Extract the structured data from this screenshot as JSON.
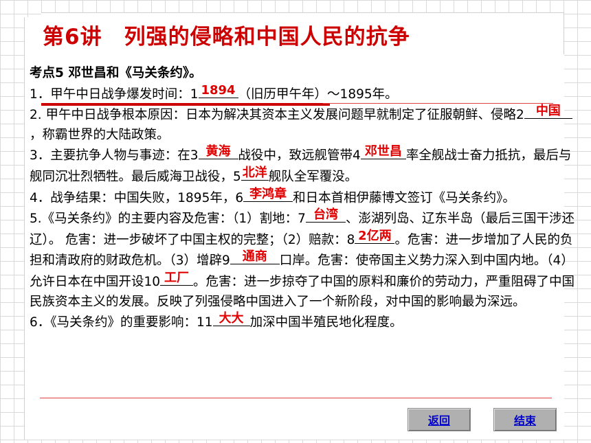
{
  "slide": {
    "title": "第6讲　列强的侵略和中国人民的抗争",
    "heading": "考点5  邓世昌和《马关条约》。",
    "items": [
      {
        "pre": "1．甲午中日战争爆发时间：1",
        "answer": "1894",
        "post": "（旧历甲午年）～1895年。"
      },
      {
        "pre": "2. 甲午中日战争根本原因：日本为解决其资本主义发展问题早就制定了征服朝鲜、侵略2",
        "answer": "中国",
        "post": "，称霸世界的大陆政策。"
      },
      {
        "pre": "3．主要抗争人物与事迹：在3",
        "answer": "黄海",
        "mid1": "战役中，致远舰管带4",
        "answer2": "邓世昌",
        "mid2": "率全舰战士奋力抵抗，最后与舰同沉壮烈牺牲。最后威海卫战役，5",
        "answer3": "北洋",
        "post": "舰队全军覆没。"
      },
      {
        "pre": "4．战争结果：中国失败，1895年，6",
        "answer": "李鸿章",
        "post": "和日本首相伊藤博文签订《马关条约》。"
      },
      {
        "pre": "5.《马关条约》的主要内容及危害：（1）割地：7",
        "answer": "台湾",
        "mid1": "、澎湖列岛、辽东半岛（最后三国干涉还辽）。 危害：进一步破坏了中国主权的完整；（2）赔款：8",
        "answer2": "2亿两",
        "mid2": "。危害：进一步增加了人民的负担和清政府的财政危机。（3）增辟9",
        "answer3": "通商",
        "mid3": "口岸。危害：使帝国主义势力深入到中国内地。（4）允许日本在中国开设10",
        "answer4": "工厂",
        "post": "。危害：进一步掠夺了中国的原料和廉价的劳动力，严重阻碍了中国民族资本主义的发展。反映了列强侵略中国进入了一个新阶段，对中国的影响最为深远。"
      },
      {
        "pre": "6．《马关条约》的重要影响：11",
        "answer": "大大",
        "post": "加深中国半殖民地化程度。"
      }
    ]
  },
  "buttons": {
    "back": "返回",
    "end": "结束"
  },
  "colors": {
    "title": "#cc0000",
    "answer": "#e00000",
    "button_text": "#0000cc"
  }
}
